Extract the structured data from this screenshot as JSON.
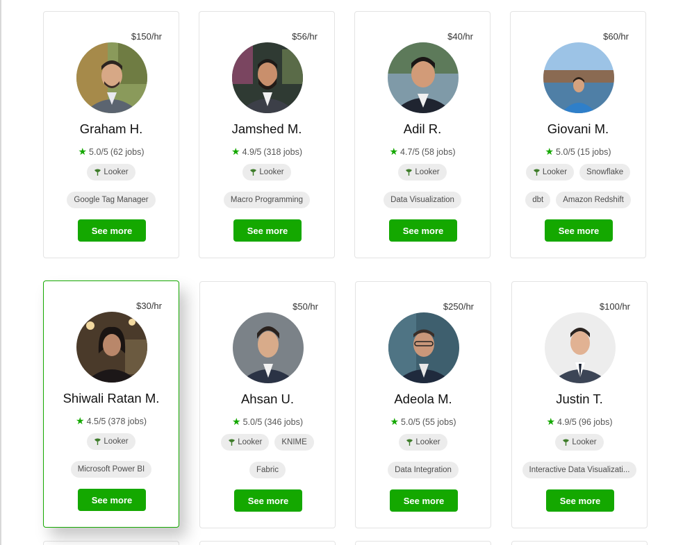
{
  "colors": {
    "accent": "#14a800",
    "tag_bg": "#ececec",
    "border": "#e3e3e3"
  },
  "icons": {
    "rating": "star-icon",
    "skill": "looker-leaf-icon"
  },
  "button_label": "See more",
  "freelancers": [
    {
      "rate": "$150/hr",
      "name": "Graham H.",
      "score": "5.0/5",
      "jobs": "(62 jobs)",
      "tags": [
        "Looker",
        "Google Tag Manager"
      ]
    },
    {
      "rate": "$56/hr",
      "name": "Jamshed M.",
      "score": "4.9/5",
      "jobs": "(318 jobs)",
      "tags": [
        "Looker",
        "Macro Programming"
      ]
    },
    {
      "rate": "$40/hr",
      "name": "Adil R.",
      "score": "4.7/5",
      "jobs": "(58 jobs)",
      "tags": [
        "Looker",
        "Data Visualization"
      ]
    },
    {
      "rate": "$60/hr",
      "name": "Giovani M.",
      "score": "5.0/5",
      "jobs": "(15 jobs)",
      "tags": [
        "Looker",
        "Snowflake",
        "dbt",
        "Amazon Redshift"
      ]
    },
    {
      "rate": "$30/hr",
      "name": "Shiwali Ratan M.",
      "score": "4.5/5",
      "jobs": "(378 jobs)",
      "tags": [
        "Looker",
        "Microsoft Power BI"
      ]
    },
    {
      "rate": "$50/hr",
      "name": "Ahsan U.",
      "score": "5.0/5",
      "jobs": "(346 jobs)",
      "tags": [
        "Looker",
        "KNIME",
        "Fabric"
      ]
    },
    {
      "rate": "$250/hr",
      "name": "Adeola M.",
      "score": "5.0/5",
      "jobs": "(55 jobs)",
      "tags": [
        "Looker",
        "Data Integration"
      ]
    },
    {
      "rate": "$100/hr",
      "name": "Justin T.",
      "score": "4.9/5",
      "jobs": "(96 jobs)",
      "tags": [
        "Looker",
        "Interactive Data Visualizati..."
      ]
    }
  ]
}
